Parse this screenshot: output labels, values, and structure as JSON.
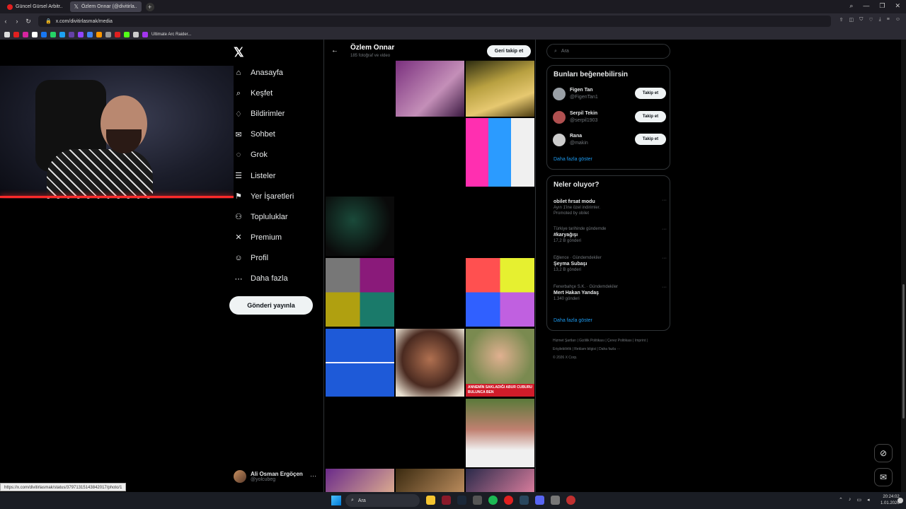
{
  "browser": {
    "tabs": [
      {
        "label": "Güncel Gürsel Arbitr..",
        "active": false
      },
      {
        "label": "Özlem Onnar (@divitirla..",
        "active": true
      }
    ],
    "new_tab": "+",
    "url": "x.com/divitirlasmak/media",
    "bookmark_label": "Ultimate Arc Raider...",
    "status_url": "https://x.com/divitirlasmak/status/37971315143842017/photo/1"
  },
  "nav": {
    "items": [
      {
        "icon": "home-icon",
        "glyph": "⌂",
        "label": "Anasayfa"
      },
      {
        "icon": "search-icon",
        "glyph": "⌕",
        "label": "Keşfet"
      },
      {
        "icon": "bell-icon",
        "glyph": "♢",
        "label": "Bildirimler"
      },
      {
        "icon": "mail-icon",
        "glyph": "✉",
        "label": "Sohbet"
      },
      {
        "icon": "grok-icon",
        "glyph": "◌",
        "label": "Grok"
      },
      {
        "icon": "list-icon",
        "glyph": "☰",
        "label": "Listeler"
      },
      {
        "icon": "bookmark-icon",
        "glyph": "⚑",
        "label": "Yer İşaretleri"
      },
      {
        "icon": "communities-icon",
        "glyph": "⚇",
        "label": "Topluluklar"
      },
      {
        "icon": "x-premium-icon",
        "glyph": "✕",
        "label": "Premium"
      },
      {
        "icon": "profile-icon",
        "glyph": "☺",
        "label": "Profil"
      },
      {
        "icon": "more-icon",
        "glyph": "⋯",
        "label": "Daha fazla"
      }
    ],
    "post_button": "Gönderi yayınla",
    "account": {
      "name": "Ali Osman Ergöçen",
      "handle": "@yolcubeg"
    }
  },
  "profile_header": {
    "name": "Özlem Onnar",
    "subtitle": "185 fotoğraf ve video",
    "follow_back_button": "Geri takip et"
  },
  "search": {
    "placeholder": "Ara"
  },
  "who_to_follow": {
    "title": "Bunları beğenebilirsin",
    "users": [
      {
        "name": "Figen Tan",
        "handle": "@FigenTan1",
        "button": "Takip et"
      },
      {
        "name": "Serpil Tekin",
        "handle": "@serpil1903",
        "button": "Takip et"
      },
      {
        "name": "Rana",
        "handle": "@makin",
        "button": "Takip et"
      }
    ],
    "show_more": "Daha fazla göster"
  },
  "trends": {
    "title": "Neler oluyor?",
    "items": [
      {
        "meta": "",
        "title": "obilet fırsat modu",
        "count": "Ayın 1'ine özel indirimler.",
        "promo": "Promoted by obilet"
      },
      {
        "meta": "Türkiye tarihinde gündemde",
        "title": "#karyağışı",
        "count": "17,2 B gönderi",
        "promo": ""
      },
      {
        "meta": "Eğlence · Gündemdekiler",
        "title": "Şeyma Subaşı",
        "count": "13,2 B gönderi",
        "promo": ""
      },
      {
        "meta": "Fenerbahçe S.K. · Gündemdekiler",
        "title": "Mert Hakan Yandaş",
        "count": "1.340 gönderi",
        "promo": ""
      }
    ],
    "show_more": "Daha fazla göster",
    "more_glyph": "···"
  },
  "footer": {
    "links": "Hizmet Şartları  |  Gizlilik Politikası  |  Çerez Politikası  |  Imprint  |  Erişilebilirlik  |  Reklam bilgisi  |  Daha fazla ···",
    "copyright": "© 2026 X Corp."
  },
  "photo_caption": "ANNEMİN SAKLADIĞI ABUR CUBURU BULUNCA BEN",
  "taskbar": {
    "search_label": "Ara",
    "time": "20:24:02",
    "date": "1.01.2026"
  },
  "colors": {
    "accent": "#1d9bf0",
    "background": "#000000",
    "border": "#2f3336"
  }
}
